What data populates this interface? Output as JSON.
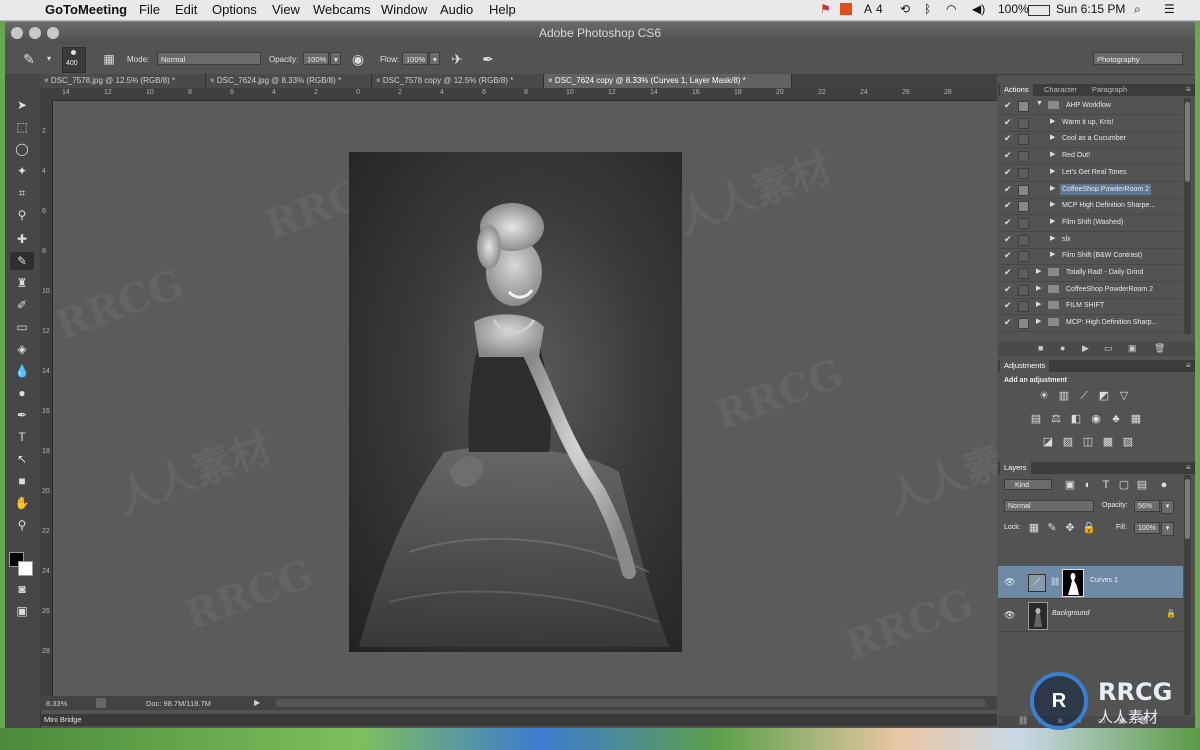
{
  "menubar": {
    "app": "GoToMeeting",
    "items": [
      "File",
      "Edit",
      "Options",
      "View",
      "Webcams",
      "Window",
      "Audio",
      "Help"
    ],
    "battery": "100%",
    "clock": "Sun 6:15 PM",
    "adobe_count": "4"
  },
  "window": {
    "title": "Adobe Photoshop CS6"
  },
  "options_bar": {
    "brush_size": "400",
    "mode_label": "Mode:",
    "mode_value": "Normal",
    "opacity_label": "Opacity:",
    "opacity_value": "100%",
    "flow_label": "Flow:",
    "flow_value": "100%",
    "workspace": "Photography"
  },
  "tabs": [
    {
      "label": "DSC_7578.jpg @ 12.5% (RGB/8) *",
      "active": false
    },
    {
      "label": "DSC_7624.jpg @ 8.33% (RGB/8) *",
      "active": false
    },
    {
      "label": "DSC_7578 copy @ 12.5% (RGB/8) *",
      "active": false
    },
    {
      "label": "DSC_7624 copy @ 8.33% (Curves 1, Layer Mask/8) *",
      "active": true
    }
  ],
  "ruler": {
    "h_labels": [
      "14",
      "12",
      "10",
      "8",
      "6",
      "4",
      "2",
      "0",
      "2",
      "4",
      "6",
      "8",
      "10",
      "12",
      "14",
      "16",
      "18",
      "20",
      "22",
      "24",
      "26",
      "28"
    ],
    "v_labels": [
      "2",
      "4",
      "6",
      "8",
      "10",
      "12",
      "14",
      "16",
      "18",
      "20",
      "22",
      "24",
      "26",
      "28"
    ]
  },
  "status": {
    "zoom": "8.33%",
    "doc": "Doc: 98.7M/118.7M"
  },
  "minibridge": "Mini Bridge",
  "actions_panel": {
    "tabs": [
      "Actions",
      "Character",
      "Paragraph"
    ],
    "rows": [
      {
        "name": "AHP Workflow",
        "level": 0,
        "type": "set",
        "open": true,
        "box": true,
        "selected": false
      },
      {
        "name": "Warm it up, Kris!",
        "level": 1,
        "type": "action",
        "box": false,
        "selected": false
      },
      {
        "name": "Cool as a Cucumber",
        "level": 1,
        "type": "action",
        "box": false,
        "selected": false
      },
      {
        "name": "Red Out!",
        "level": 1,
        "type": "action",
        "box": false,
        "selected": false
      },
      {
        "name": "Let's Get Real Tones",
        "level": 1,
        "type": "action",
        "box": false,
        "selected": false
      },
      {
        "name": "CoffeeShop PowderRoom 2",
        "level": 1,
        "type": "action",
        "box": true,
        "selected": true
      },
      {
        "name": "MCP High Definition Sharpe...",
        "level": 1,
        "type": "action",
        "box": true,
        "selected": false
      },
      {
        "name": "Film Shift (Washed)",
        "level": 1,
        "type": "action",
        "box": false,
        "selected": false
      },
      {
        "name": "slx",
        "level": 1,
        "type": "action",
        "box": false,
        "selected": false
      },
      {
        "name": "Film Shift (B&W Contrast)",
        "level": 1,
        "type": "action",
        "box": false,
        "selected": false
      },
      {
        "name": "Totally Rad! - Daily Grind",
        "level": 0,
        "type": "set",
        "open": false,
        "box": false,
        "selected": false
      },
      {
        "name": "CoffeeShop PowderRoom 2",
        "level": 0,
        "type": "set",
        "open": false,
        "box": false,
        "selected": false
      },
      {
        "name": "FILM SHIFT",
        "level": 0,
        "type": "set",
        "open": false,
        "box": false,
        "selected": false
      },
      {
        "name": "MCP: High Definition Sharp...",
        "level": 0,
        "type": "set",
        "open": false,
        "box": true,
        "selected": false
      }
    ]
  },
  "adjustments_panel": {
    "tab": "Adjustments",
    "hint": "Add an adjustment"
  },
  "layers_panel": {
    "tab": "Layers",
    "kind": "Kind",
    "blend": "Normal",
    "opacity_label": "Opacity:",
    "opacity": "56%",
    "lock_label": "Lock:",
    "fill_label": "Fill:",
    "fill": "100%",
    "layers": [
      {
        "name": "Curves 1",
        "selected": true
      },
      {
        "name": "Background",
        "selected": false
      }
    ]
  },
  "watermark": {
    "text_latin": "RRCG",
    "text_cn": "人人素材"
  },
  "colors": {
    "selection": "#6e8aa6",
    "panel": "#535353",
    "canvas": "#5b5b5b"
  }
}
